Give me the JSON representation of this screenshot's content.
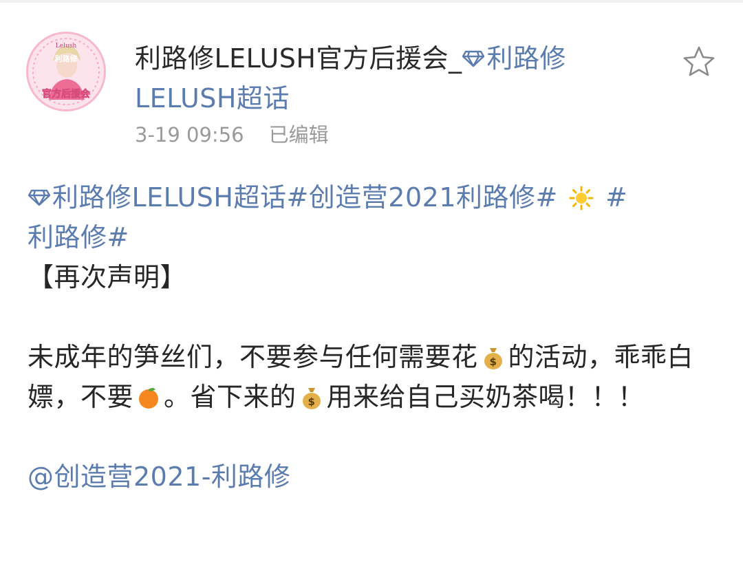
{
  "post": {
    "author": "利路修LELUSH官方后援会_",
    "author_link": "利路修LELUSH超话",
    "avatar_text_top": "Lelush",
    "avatar_text_mid": "利路修",
    "avatar_text_bottom": "官方后援会",
    "time": "3-19 09:56",
    "edited": "已编辑",
    "topic_supertalk": "利路修LELUSH超话",
    "topic_1": "#创造营2021利路修#",
    "topic_2_hash": "#",
    "topic_2_rest": "利路修#",
    "heading": "【再次声明】",
    "body_part1": "未成年的笋丝们，不要参与任何需要花",
    "body_part2": "的活动，乖乖白嫖，不要",
    "body_part3": "。省下来的",
    "body_part4": "用来给自己买奶茶喝！！！",
    "mention": "@创造营2021-利路修"
  },
  "icons": {
    "star": "star-outline-icon",
    "diamond": "supertalk-diamond-icon",
    "sun": "sun-emoji",
    "money_bag": "money-bag-emoji",
    "orange": "tangerine-emoji"
  },
  "colors": {
    "link": "#5b7cae",
    "text": "#262626",
    "meta": "#9a9a9a"
  }
}
